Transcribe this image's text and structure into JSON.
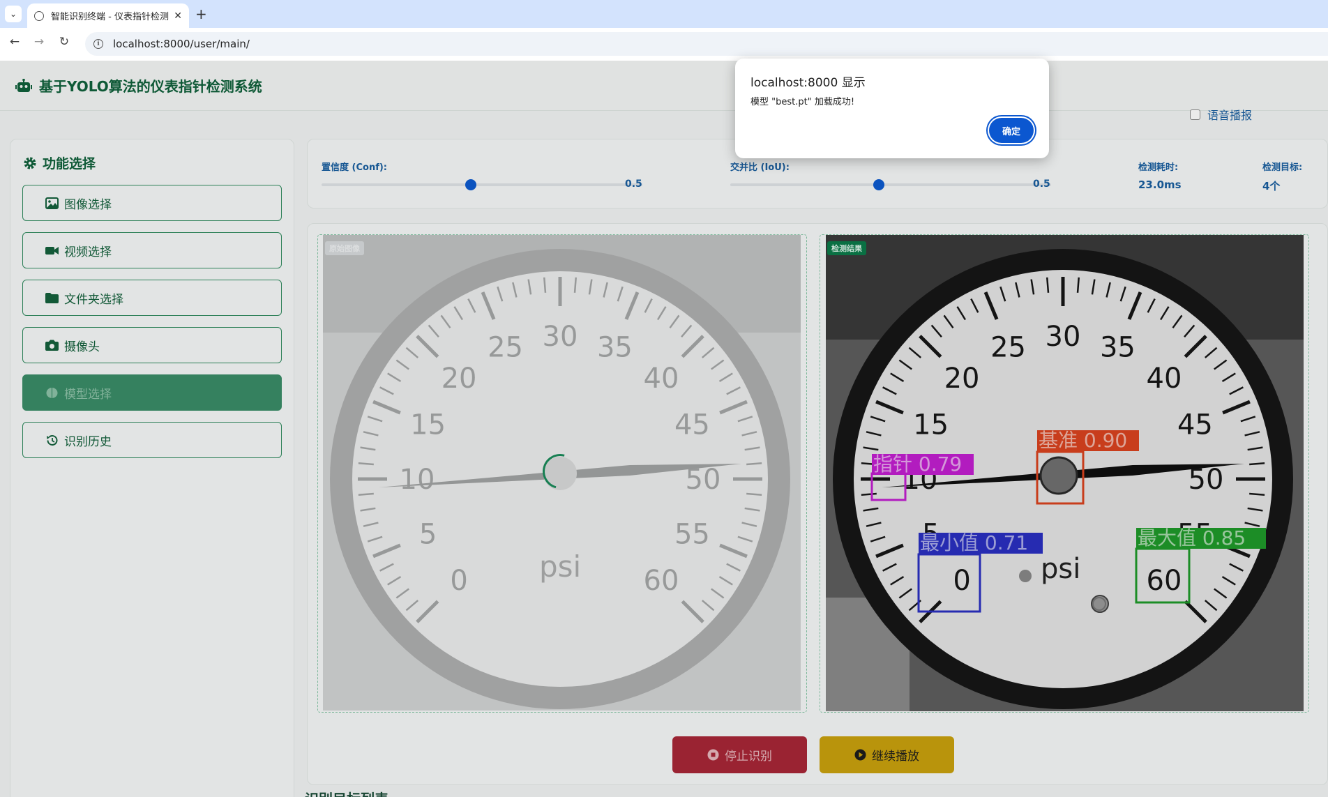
{
  "browser": {
    "tab_title": "智能识别终端 - 仪表指针检测系统",
    "url": "localhost:8000/user/main/"
  },
  "header": {
    "title": "基于YOLO算法的仪表指针检测系统",
    "icon": "robot-icon"
  },
  "sidebar": {
    "title": "功能选择",
    "items": [
      {
        "label": "图像选择",
        "icon": "image-icon"
      },
      {
        "label": "视频选择",
        "icon": "video-camera-icon"
      },
      {
        "label": "文件夹选择",
        "icon": "folder-icon"
      },
      {
        "label": "摄像头",
        "icon": "camera-icon"
      },
      {
        "label": "模型选择",
        "icon": "brain-icon",
        "active": true
      },
      {
        "label": "识别历史",
        "icon": "history-icon"
      }
    ]
  },
  "controls": {
    "conf_label": "置信度 (Conf):",
    "conf_value": "0.5",
    "iou_label": "交并比 (IoU):",
    "iou_value": "0.5",
    "time_label": "检测耗时:",
    "time_value": "23.0ms",
    "voice_label": "语音播报",
    "targets_label": "检测目标:",
    "targets_value": "4个"
  },
  "panels": {
    "original_badge": "原始图像",
    "result_badge": "检测结果"
  },
  "gauge": {
    "ticks": [
      "0",
      "5",
      "10",
      "15",
      "20",
      "25",
      "30",
      "35",
      "40",
      "45",
      "50",
      "55",
      "60"
    ],
    "unit": "psi"
  },
  "detections": [
    {
      "label": "指针 0.79",
      "color": "#c21fd0"
    },
    {
      "label": "基准 0.90",
      "color": "#d9431f"
    },
    {
      "label": "最小值 0.71",
      "color": "#2a2fc0"
    },
    {
      "label": "最大值 0.85",
      "color": "#1f9a2a"
    }
  ],
  "actions": {
    "stop_label": "停止识别",
    "play_label": "继续播放"
  },
  "list_title": "识别目标列表",
  "dialog": {
    "title": "localhost:8000 显示",
    "message": "模型 \"best.pt\" 加载成功!",
    "ok_label": "确定"
  },
  "colors": {
    "brand_green": "#10613b",
    "accent_blue": "#0b57d0",
    "stop_red": "#a82637",
    "play_yellow": "#c9a10e"
  }
}
